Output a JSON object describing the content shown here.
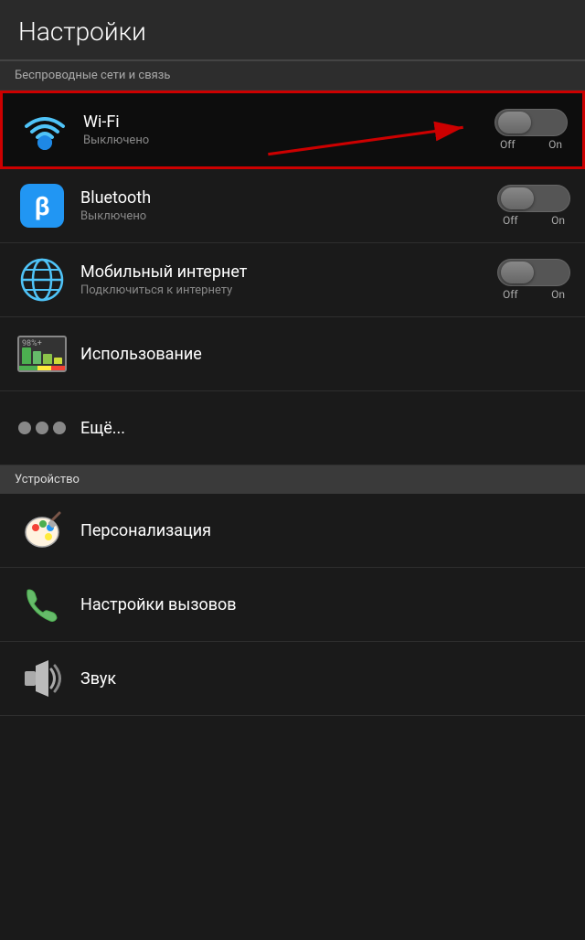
{
  "header": {
    "title": "Настройки"
  },
  "wireless_section": {
    "label": "Беспроводные сети и связь"
  },
  "items": [
    {
      "id": "wifi",
      "title": "Wi-Fi",
      "subtitle": "Выключено",
      "toggle": true,
      "off_label": "Off",
      "on_label": "On",
      "highlighted": true
    },
    {
      "id": "bluetooth",
      "title": "Bluetooth",
      "subtitle": "Выключено",
      "toggle": true,
      "off_label": "Off",
      "on_label": "On",
      "highlighted": false
    },
    {
      "id": "mobile",
      "title": "Мобильный интернет",
      "subtitle": "Подключиться к интернету",
      "toggle": true,
      "off_label": "Off",
      "on_label": "On",
      "highlighted": false
    },
    {
      "id": "usage",
      "title": "Использование",
      "subtitle": "",
      "toggle": false,
      "highlighted": false
    },
    {
      "id": "more",
      "title": "Ещё...",
      "subtitle": "",
      "toggle": false,
      "highlighted": false
    }
  ],
  "device_section": {
    "label": "Устройство"
  },
  "device_items": [
    {
      "id": "personalization",
      "title": "Персонализация",
      "subtitle": ""
    },
    {
      "id": "calls",
      "title": "Настройки вызовов",
      "subtitle": ""
    },
    {
      "id": "sound",
      "title": "Звук",
      "subtitle": ""
    }
  ]
}
